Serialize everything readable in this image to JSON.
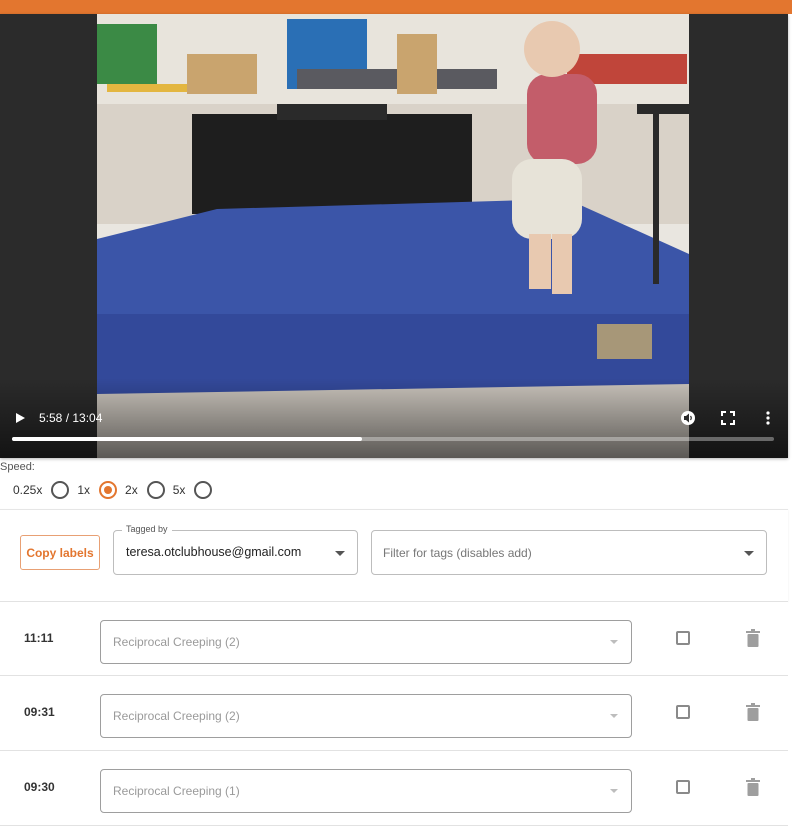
{
  "colors": {
    "accent": "#e3762f",
    "player_bg": "#2b2b2b"
  },
  "player": {
    "time_display": "5:58 / 13:04",
    "progress_fraction": 0.459,
    "icons": [
      "play-icon",
      "volume-icon",
      "fullscreen-icon",
      "more-vert-icon"
    ]
  },
  "speed": {
    "label": "Speed:",
    "options": [
      {
        "label": "0.25x",
        "selected": false
      },
      {
        "label": "1x",
        "selected": true
      },
      {
        "label": "2x",
        "selected": false
      },
      {
        "label": "5x",
        "selected": false
      }
    ]
  },
  "toolbar": {
    "copy_label": "Copy labels",
    "tagged_by_legend": "Tagged by",
    "tagged_by_value": "teresa.otclubhouse@gmail.com",
    "filter_placeholder": "Filter for tags (disables add)"
  },
  "tags": [
    {
      "time": "11:11",
      "label": "Reciprocal Creeping (2)",
      "checked": false
    },
    {
      "time": "09:31",
      "label": "Reciprocal Creeping (2)",
      "checked": false
    },
    {
      "time": "09:30",
      "label": "Reciprocal Creeping (1)",
      "checked": false
    }
  ]
}
